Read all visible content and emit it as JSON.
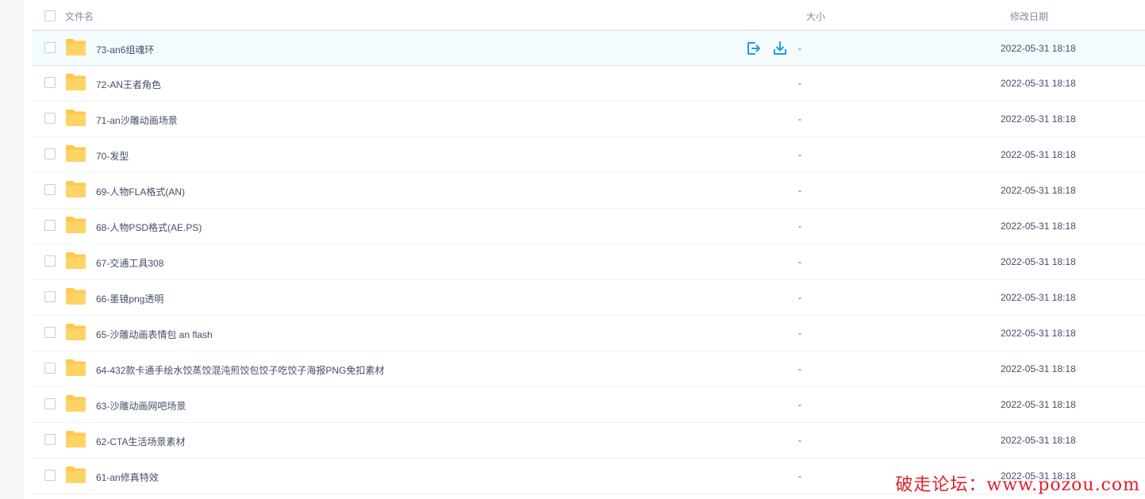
{
  "header": {
    "name_label": "文件名",
    "size_label": "大小",
    "date_label": "修改日期"
  },
  "colors": {
    "accent": "#1b9aee",
    "folder": "#ffc94d",
    "hover_bg": "#f4fbff",
    "watermark": "#e0202a"
  },
  "rows": [
    {
      "name": "73-an6组魂环",
      "size": "-",
      "date": "2022-05-31 18:18",
      "hovered": true
    },
    {
      "name": "72-AN王者角色",
      "size": "-",
      "date": "2022-05-31 18:18"
    },
    {
      "name": "71-an沙雕动画场景",
      "size": "-",
      "date": "2022-05-31 18:18"
    },
    {
      "name": "70-发型",
      "size": "-",
      "date": "2022-05-31 18:18"
    },
    {
      "name": "69-人物FLA格式(AN)",
      "size": "-",
      "date": "2022-05-31 18:18"
    },
    {
      "name": "68-人物PSD格式(AE.PS)",
      "size": "-",
      "date": "2022-05-31 18:18"
    },
    {
      "name": "67-交通工具308",
      "size": "-",
      "date": "2022-05-31 18:18"
    },
    {
      "name": "66-墨镜png透明",
      "size": "-",
      "date": "2022-05-31 18:18"
    },
    {
      "name": "65-沙雕动画表情包 an flash",
      "size": "-",
      "date": "2022-05-31 18:18"
    },
    {
      "name": "64-432款卡通手绘水饺蒸饺混沌煎饺包饺子吃饺子海报PNG免扣素材",
      "size": "-",
      "date": "2022-05-31 18:18"
    },
    {
      "name": "63-沙雕动画网吧场景",
      "size": "-",
      "date": "2022-05-31 18:18"
    },
    {
      "name": "62-CTA生活场景素材",
      "size": "-",
      "date": "2022-05-31 18:18"
    },
    {
      "name": "61-an修真特效",
      "size": "-",
      "date": "2022-05-31 18:18"
    }
  ],
  "row_actions": {
    "share_icon": "share-out-icon",
    "download_icon": "download-icon"
  },
  "watermark": "破走论坛：www.pozou.com"
}
